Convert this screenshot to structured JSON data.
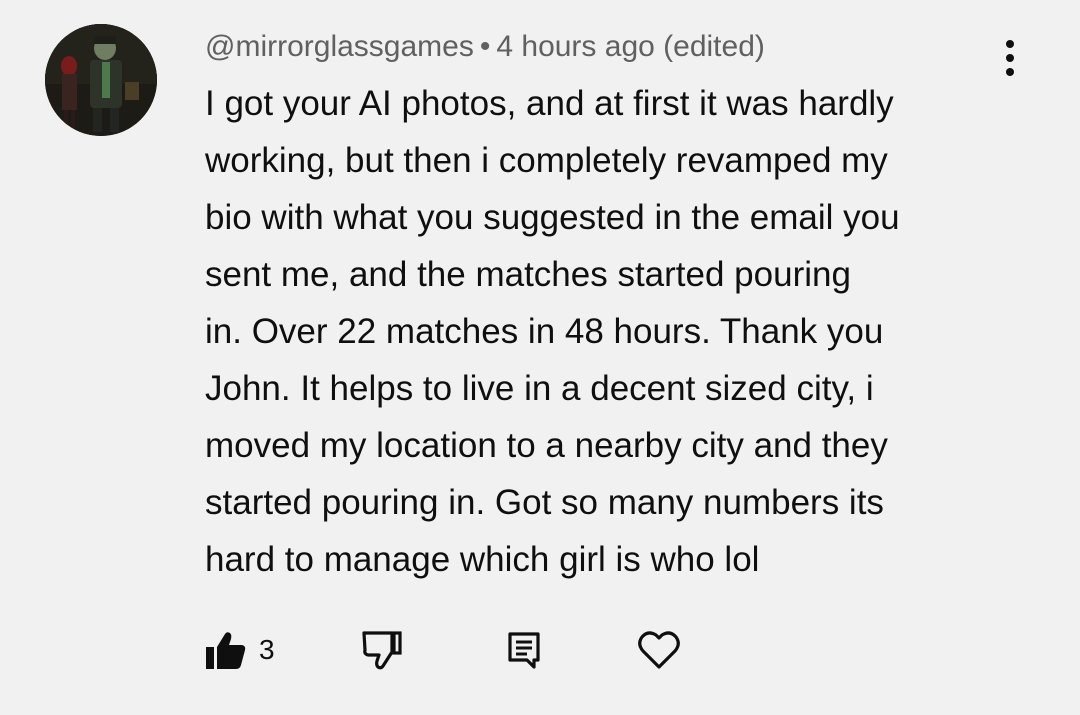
{
  "comment": {
    "author": "@mirrorglassgames",
    "separator": "•",
    "timestamp": "4 hours ago (edited)",
    "body_lines": [
      "I got your AI photos, and at first it was hardly",
      "working, but then i completely revamped my",
      "bio with what you suggested in the email you",
      "sent me, and the matches started pouring",
      "in. Over 22 matches in 48 hours. Thank you",
      "John. It helps to live in a decent sized city, i",
      "moved my location to a nearby city and they",
      "started pouring in. Got so many numbers its",
      "hard to manage which girl is who lol"
    ]
  },
  "actions": {
    "like_count": "3",
    "icons": [
      "thumbs-up-icon",
      "thumbs-down-icon",
      "reply-icon",
      "heart-icon",
      "more-vert-icon"
    ]
  },
  "colors": {
    "background": "#f1f1f1",
    "text": "#0f0f0f",
    "meta_text": "#606060"
  }
}
